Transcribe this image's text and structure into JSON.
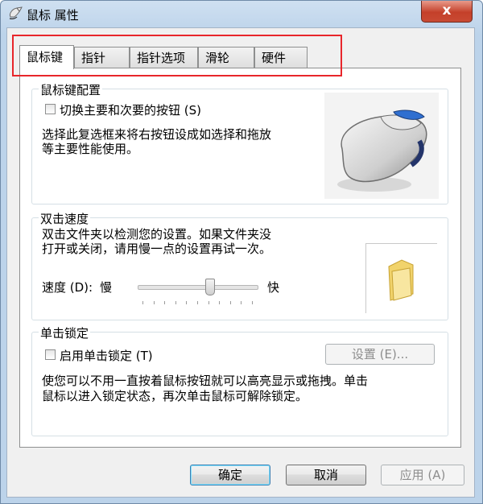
{
  "window": {
    "title": "鼠标 属性",
    "close_label": "x"
  },
  "tabs": [
    {
      "label": "鼠标键",
      "active": true
    },
    {
      "label": "指针",
      "active": false
    },
    {
      "label": "指针选项",
      "active": false
    },
    {
      "label": "滑轮",
      "active": false
    },
    {
      "label": "硬件",
      "active": false
    }
  ],
  "button_config": {
    "title": "鼠标键配置",
    "switch_checkbox_label": "切换主要和次要的按钮 (S)",
    "switch_checked": false,
    "description_line1": "选择此复选框来将右按钮设成如选择和拖放",
    "description_line2": "等主要性能使用。",
    "image_icon": "mouse-image"
  },
  "double_click": {
    "title": "双击速度",
    "description_line1": "双击文件夹以检测您的设置。如果文件夹没",
    "description_line2": "打开或关闭，请用慢一点的设置再试一次。",
    "speed_label": "速度 (D):",
    "slow_label": "慢",
    "fast_label": "快",
    "speed_fraction": 0.6,
    "test_icon": "folder-icon"
  },
  "click_lock": {
    "title": "单击锁定",
    "checkbox_label": "启用单击锁定 (T)",
    "checked": false,
    "settings_label": "设置 (E)...",
    "description_line1": "使您可以不用一直按着鼠标按钮就可以高亮显示或拖拽。单击",
    "description_line2": "鼠标以进入锁定状态，再次单击鼠标可解除锁定。"
  },
  "footer": {
    "ok_label": "确定",
    "cancel_label": "取消",
    "apply_label": "应用 (A)"
  },
  "colors": {
    "highlight": "#e8262b",
    "title_gradient": "#cfe0f1",
    "close_button": "#c4402a"
  }
}
